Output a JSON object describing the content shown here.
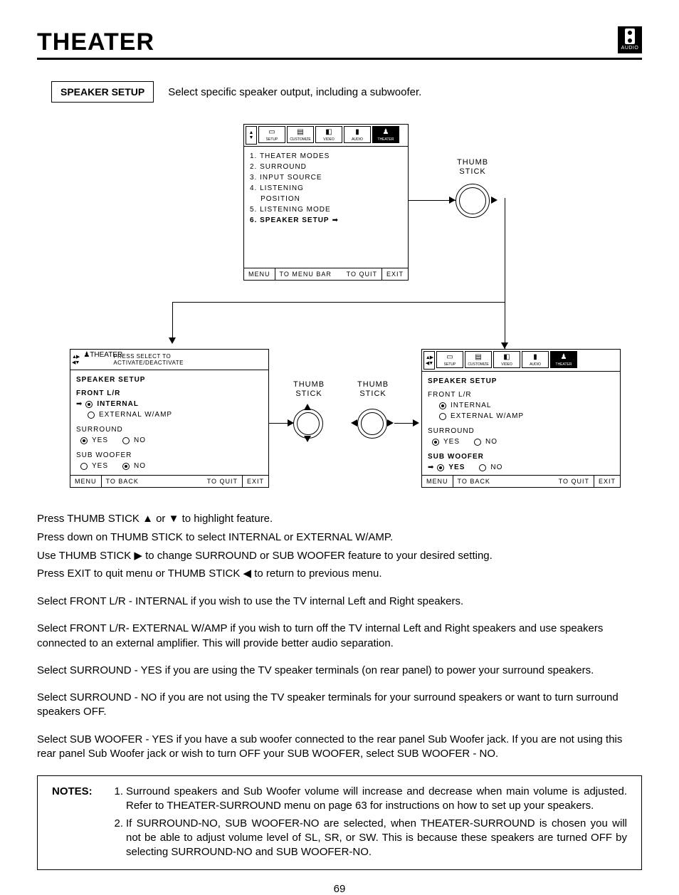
{
  "header": {
    "title": "THEATER",
    "audio_label": "AUDIO"
  },
  "speaker_setup": {
    "box_label": "SPEAKER SETUP",
    "intro": "Select specific speaker output, including a subwoofer."
  },
  "panel_top": {
    "icons": [
      "SETUP",
      "CUSTOMIZE",
      "VIDEO",
      "AUDIO",
      "THEATER"
    ],
    "items": [
      "1. THEATER MODES",
      "2. SURROUND",
      "3. INPUT SOURCE",
      "4. LISTENING",
      "    POSITION",
      "5. LISTENING MODE"
    ],
    "highlight": "6. SPEAKER SETUP",
    "foot_menu": "MENU",
    "foot_mid": "TO MENU BAR",
    "foot_quit": "TO QUIT",
    "foot_exit": "EXIT"
  },
  "thumb_stick": "THUMB\nSTICK",
  "panel_left": {
    "head_icon": "THEATER",
    "head_text": "PRESS SELECT TO\nACTIVATE/DEACTIVATE",
    "title": "SPEAKER SETUP",
    "front_lr": "FRONT L/R",
    "opt_internal": "INTERNAL",
    "opt_external": "EXTERNAL W/AMP",
    "surround": "SURROUND",
    "yes": "YES",
    "no": "NO",
    "sub": "SUB WOOFER",
    "foot_menu": "MENU",
    "foot_back": "TO BACK",
    "foot_quit": "TO QUIT",
    "foot_exit": "EXIT"
  },
  "panel_right": {
    "icons": [
      "SETUP",
      "CUSTOMIZE",
      "VIDEO",
      "AUDIO",
      "THEATER"
    ],
    "title": "SPEAKER SETUP",
    "front_lr": "FRONT L/R",
    "opt_internal": "INTERNAL",
    "opt_external": "EXTERNAL W/AMP",
    "surround": "SURROUND",
    "yes": "YES",
    "no": "NO",
    "sub": "SUB WOOFER",
    "foot_menu": "MENU",
    "foot_back": "TO BACK",
    "foot_quit": "TO QUIT",
    "foot_exit": "EXIT"
  },
  "instructions": {
    "l1": "Press THUMB STICK ▲ or ▼ to highlight feature.",
    "l2": "Press down on THUMB STICK to select INTERNAL or EXTERNAL W/AMP.",
    "l3": "Use THUMB STICK ▶ to change SURROUND or SUB WOOFER feature to your desired setting.",
    "l4": "Press EXIT to quit menu or THUMB STICK ◀ to return to previous menu."
  },
  "paragraphs": {
    "p1": "Select FRONT L/R - INTERNAL if you wish to use the TV internal Left and Right speakers.",
    "p2": "Select FRONT L/R- EXTERNAL W/AMP if you wish to turn off the TV internal Left and Right speakers and use speakers connected to an external amplifier.  This will provide better audio separation.",
    "p3": "Select SURROUND - YES if you are using the TV speaker terminals (on rear panel) to power your surround speakers.",
    "p4": "Select SURROUND - NO if you are not using the TV speaker terminals for your surround speakers or want to turn surround speakers OFF.",
    "p5": "Select SUB WOOFER - YES if you have a sub woofer connected to the rear panel Sub Woofer jack.  If you are not using this rear panel Sub Woofer jack or wish to turn OFF your SUB WOOFER, select SUB WOOFER - NO."
  },
  "notes": {
    "label": "NOTES:",
    "n1": "Surround speakers and Sub Woofer volume will increase and decrease when main volume is adjusted.  Refer to THEATER-SURROUND menu on page 63 for instructions on how to set up your speakers.",
    "n2": "If SURROUND-NO, SUB WOOFER-NO are selected, when THEATER-SURROUND is chosen you will not be able to adjust volume level of SL, SR, or SW.  This is because these speakers are turned OFF by selecting SURROUND-NO and SUB WOOFER-NO."
  },
  "page_number": "69"
}
